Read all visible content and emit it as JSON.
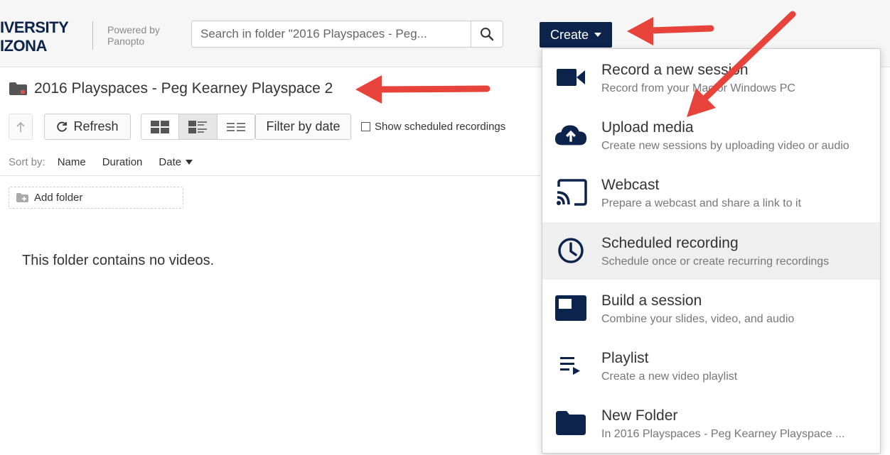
{
  "header": {
    "logo_line1": "IVERSITY",
    "logo_line2": "IZONA",
    "powered_line1": "Powered by",
    "powered_line2": "Panopto",
    "search_placeholder": "Search in folder \"2016 Playspaces - Peg...",
    "create_label": "Create"
  },
  "folder": {
    "title": "2016 Playspaces - Peg Kearney Playspace 2",
    "empty_message": "This folder contains no videos."
  },
  "toolbar": {
    "refresh_label": "Refresh",
    "filter_label": "Filter by date",
    "show_scheduled_label": "Show scheduled recordings"
  },
  "sort": {
    "label": "Sort by:",
    "options": [
      "Name",
      "Duration",
      "Date"
    ]
  },
  "add_folder_label": "Add folder",
  "create_menu": {
    "items": [
      {
        "title": "Record a new session",
        "subtitle": "Record from your Mac or Windows PC",
        "icon": "video-camera-icon"
      },
      {
        "title": "Upload media",
        "subtitle": "Create new sessions by uploading video or audio",
        "icon": "cloud-upload-icon"
      },
      {
        "title": "Webcast",
        "subtitle": "Prepare a webcast and share a link to it",
        "icon": "cast-icon"
      },
      {
        "title": "Scheduled recording",
        "subtitle": "Schedule once or create recurring recordings",
        "icon": "clock-icon"
      },
      {
        "title": "Build a session",
        "subtitle": "Combine your slides, video, and audio",
        "icon": "build-session-icon"
      },
      {
        "title": "Playlist",
        "subtitle": "Create a new video playlist",
        "icon": "playlist-icon"
      },
      {
        "title": "New Folder",
        "subtitle": "In 2016 Playspaces - Peg Kearney Playspace ...",
        "icon": "folder-icon"
      }
    ]
  },
  "colors": {
    "brand_navy": "#0c234b",
    "annotation_red": "#e8433a",
    "highlight_row": "#efefef"
  }
}
